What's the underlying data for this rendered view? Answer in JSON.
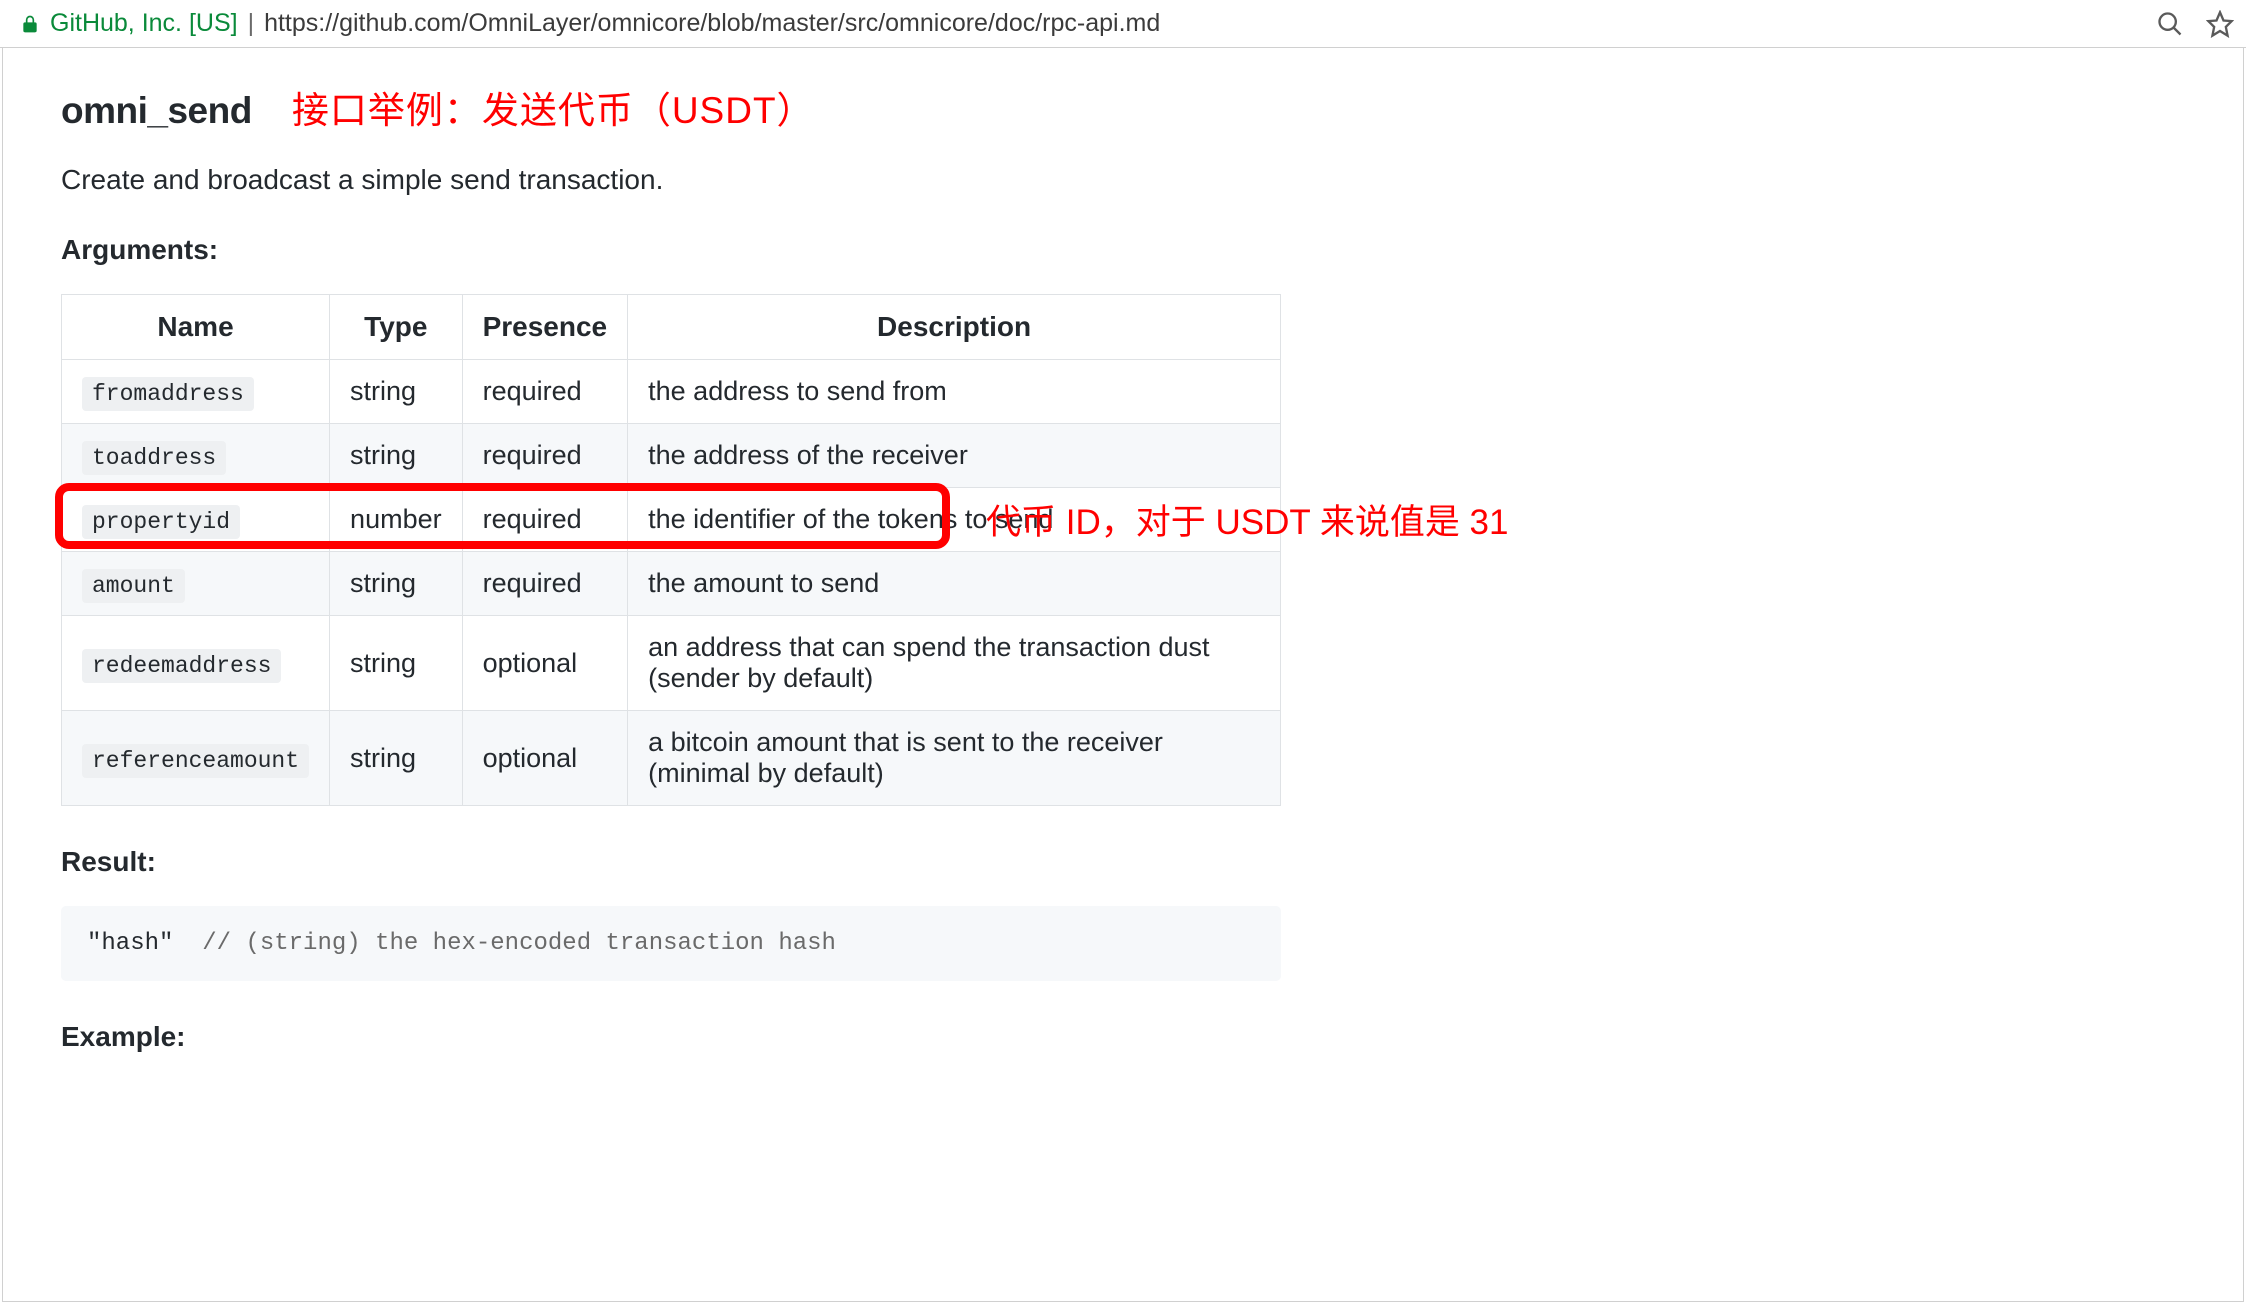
{
  "browser": {
    "site_name": "GitHub, Inc. [US]",
    "url": "https://github.com/OmniLayer/omnicore/blob/master/src/omnicore/doc/rpc-api.md"
  },
  "heading": {
    "api_name": "omni_send",
    "annotation_red": "接口举例：发送代币（USDT）"
  },
  "description": "Create and broadcast a simple send transaction.",
  "sections": {
    "arguments_label": "Arguments:",
    "result_label": "Result:",
    "example_label": "Example:"
  },
  "table": {
    "headers": {
      "name": "Name",
      "type": "Type",
      "presence": "Presence",
      "description": "Description"
    },
    "rows": [
      {
        "name": "fromaddress",
        "type": "string",
        "presence": "required",
        "description": "the address to send from"
      },
      {
        "name": "toaddress",
        "type": "string",
        "presence": "required",
        "description": "the address of the receiver"
      },
      {
        "name": "propertyid",
        "type": "number",
        "presence": "required",
        "description": "the identifier of the tokens to send"
      },
      {
        "name": "amount",
        "type": "string",
        "presence": "required",
        "description": "the amount to send"
      },
      {
        "name": "redeemaddress",
        "type": "string",
        "presence": "optional",
        "description": "an address that can spend the transaction dust (sender by default)"
      },
      {
        "name": "referenceamount",
        "type": "string",
        "presence": "optional",
        "description": "a bitcoin amount that is sent to the receiver (minimal by default)"
      }
    ],
    "highlight_row_index": 2,
    "side_annotation": "代币 ID，对于 USDT 来说值是 31"
  },
  "result_code": {
    "literal": "\"hash\"",
    "comment": "// (string) the hex-encoded transaction hash"
  }
}
